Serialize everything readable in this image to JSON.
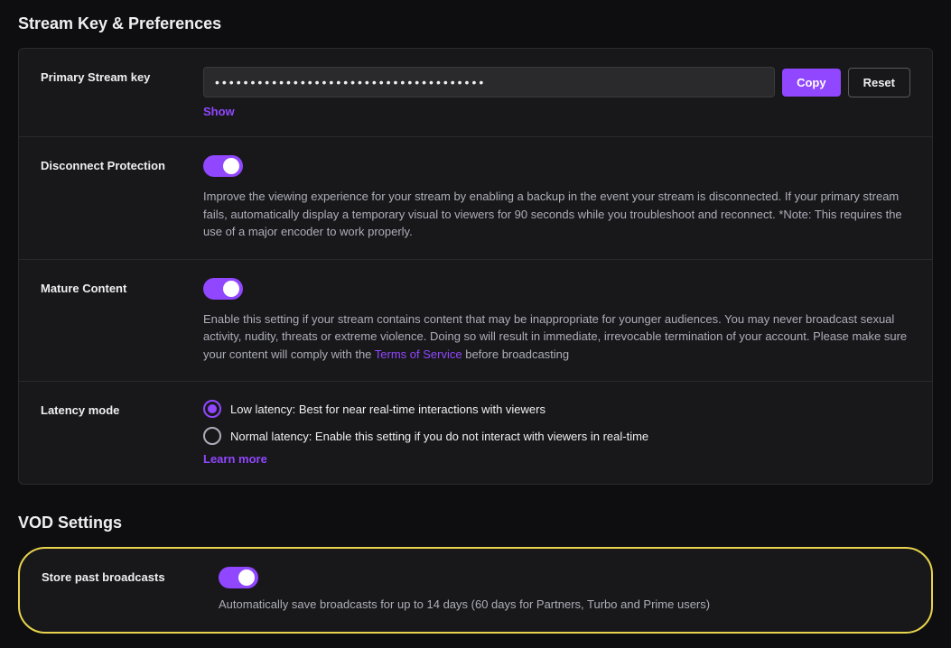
{
  "page": {
    "main_title": "Stream Key & Preferences",
    "vod_title": "VOD Settings"
  },
  "stream_key": {
    "label": "Primary Stream key",
    "value": "••••••••••••••••••••••••••••••••••••••",
    "copy_label": "Copy",
    "reset_label": "Reset",
    "show_label": "Show"
  },
  "disconnect_protection": {
    "label": "Disconnect Protection",
    "enabled": true,
    "description": "Improve the viewing experience for your stream by enabling a backup in the event your stream is disconnected. If your primary stream fails, automatically display a temporary visual to viewers for 90 seconds while you troubleshoot and reconnect. *Note: This requires the use of a major encoder to work properly."
  },
  "mature_content": {
    "label": "Mature Content",
    "enabled": true,
    "description_before": "Enable this setting if your stream contains content that may be inappropriate for younger audiences. You may never broadcast sexual activity, nudity, threats or extreme violence. Doing so will result in immediate, irrevocable termination of your account. Please make sure your content will comply with the ",
    "terms_link_label": "Terms of Service",
    "description_after": " before broadcasting"
  },
  "latency_mode": {
    "label": "Latency mode",
    "options": [
      {
        "id": "low",
        "label": "Low latency: Best for near real-time interactions with viewers",
        "selected": true
      },
      {
        "id": "normal",
        "label": "Normal latency: Enable this setting if you do not interact with viewers in real-time",
        "selected": false
      }
    ],
    "learn_more_label": "Learn more"
  },
  "vod_settings": {
    "store_past_broadcasts": {
      "label": "Store past broadcasts",
      "enabled": true,
      "description": "Automatically save broadcasts for up to 14 days (60 days for Partners, Turbo and Prime users)"
    }
  }
}
